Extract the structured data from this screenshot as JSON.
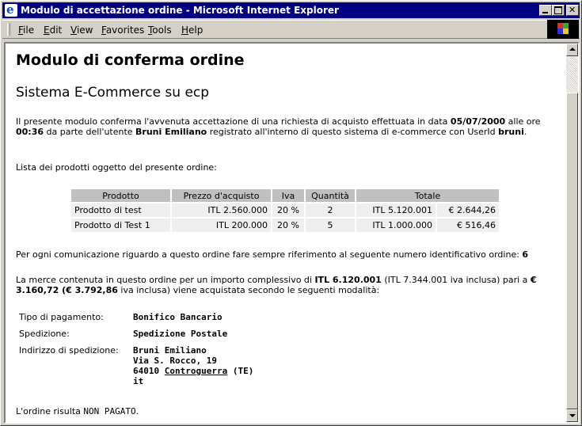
{
  "window": {
    "title": "Modulo di accettazione ordine - Microsoft Internet Explorer"
  },
  "menu": {
    "items": [
      "File",
      "Edit",
      "View",
      "Favorites",
      "Tools",
      "Help"
    ]
  },
  "page": {
    "heading": "Modulo di conferma ordine",
    "subheading": "Sistema E-Commerce su  ecp",
    "intro": {
      "t1": "Il presente modulo conferma l'avvenuta accettazione di una richiesta di acquisto effettuata in data ",
      "date": "05/07/2000",
      "t2": " alle ore ",
      "time": "00:36",
      "t3": " da parte dell'utente ",
      "user_name": "Bruni Emiliano",
      "t4": " registrato all'interno di questo sistema di e-commerce con UserId ",
      "user_id": "bruni",
      "t5": "."
    },
    "list_intro": "Lista dei prodotti oggetto del presente ordine:",
    "table": {
      "headers": [
        "Prodotto",
        "Prezzo d'acquisto",
        "Iva",
        "Quantità",
        "Totale"
      ],
      "rows": [
        {
          "product": "Prodotto di test",
          "price": "ITL 2.560.000",
          "vat": "20 %",
          "qty": "2",
          "total_itl": "ITL 5.120.001",
          "total_eur": "€ 2.644,26"
        },
        {
          "product": "Prodotto di Test 1",
          "price": "ITL 200.000",
          "vat": "20 %",
          "qty": "5",
          "total_itl": "ITL 1.000.000",
          "total_eur": "€ 516,46"
        }
      ]
    },
    "reference": {
      "text": "Per ogni comunicazione riguardo a questo ordine fare sempre riferimento al seguente numero identificativo ordine: ",
      "order_id": "6"
    },
    "total": {
      "t1": "La merce contenuta in questo ordine per  un importo complessivo di ",
      "amount_itl": "ITL 6.120.001",
      "t2": " (ITL 7.344.001 iva inclusa) pari a ",
      "amount_eur": "€ 3.160,72 (€ 3.792,86",
      "t3": " iva inclusa) viene acquistata secondo le seguenti modalità:"
    },
    "details": {
      "payment_label": "Tipo di pagamento:",
      "payment_value": "Bonifico Bancario",
      "shipping_label": "Spedizione:",
      "shipping_value": "Spedizione Postale",
      "address_label": "Indirizzo di spedizione:",
      "address": {
        "name": "Bruni Emiliano",
        "street": "Via S. Rocco, 19",
        "zip": "64010 ",
        "city": "Controguerra",
        "province": " (TE)",
        "country": "it"
      }
    },
    "status": {
      "t1": "L'ordine risulta ",
      "value": "NON PAGATO",
      "t2": "."
    }
  }
}
